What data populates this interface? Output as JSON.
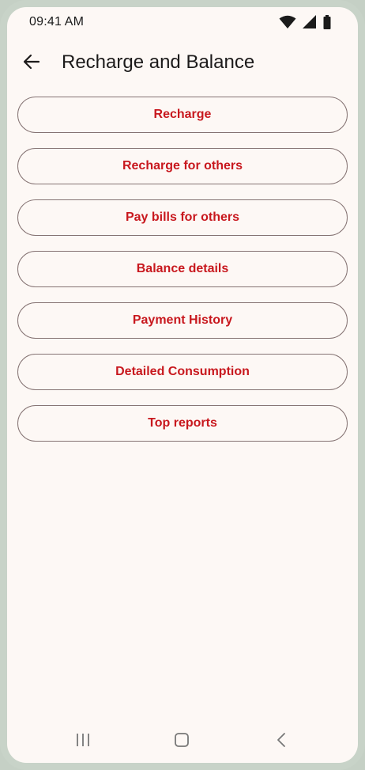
{
  "status_bar": {
    "time": "09:41 AM",
    "icons": [
      "wifi-icon",
      "signal-icon",
      "battery-icon"
    ]
  },
  "app_bar": {
    "title": "Recharge and Balance",
    "back_icon": "arrow-left-icon"
  },
  "menu": {
    "items": [
      {
        "label": "Recharge"
      },
      {
        "label": "Recharge for others"
      },
      {
        "label": "Pay bills for others"
      },
      {
        "label": "Balance details"
      },
      {
        "label": "Payment History"
      },
      {
        "label": "Detailed Consumption"
      },
      {
        "label": "Top reports"
      }
    ]
  },
  "nav_bar": {
    "icons": [
      "recent-apps-icon",
      "home-icon",
      "back-nav-icon"
    ]
  },
  "colors": {
    "accent": "#c8181e",
    "background": "#fdf8f5",
    "outline": "#857373",
    "frame": "#c8d3c8"
  }
}
